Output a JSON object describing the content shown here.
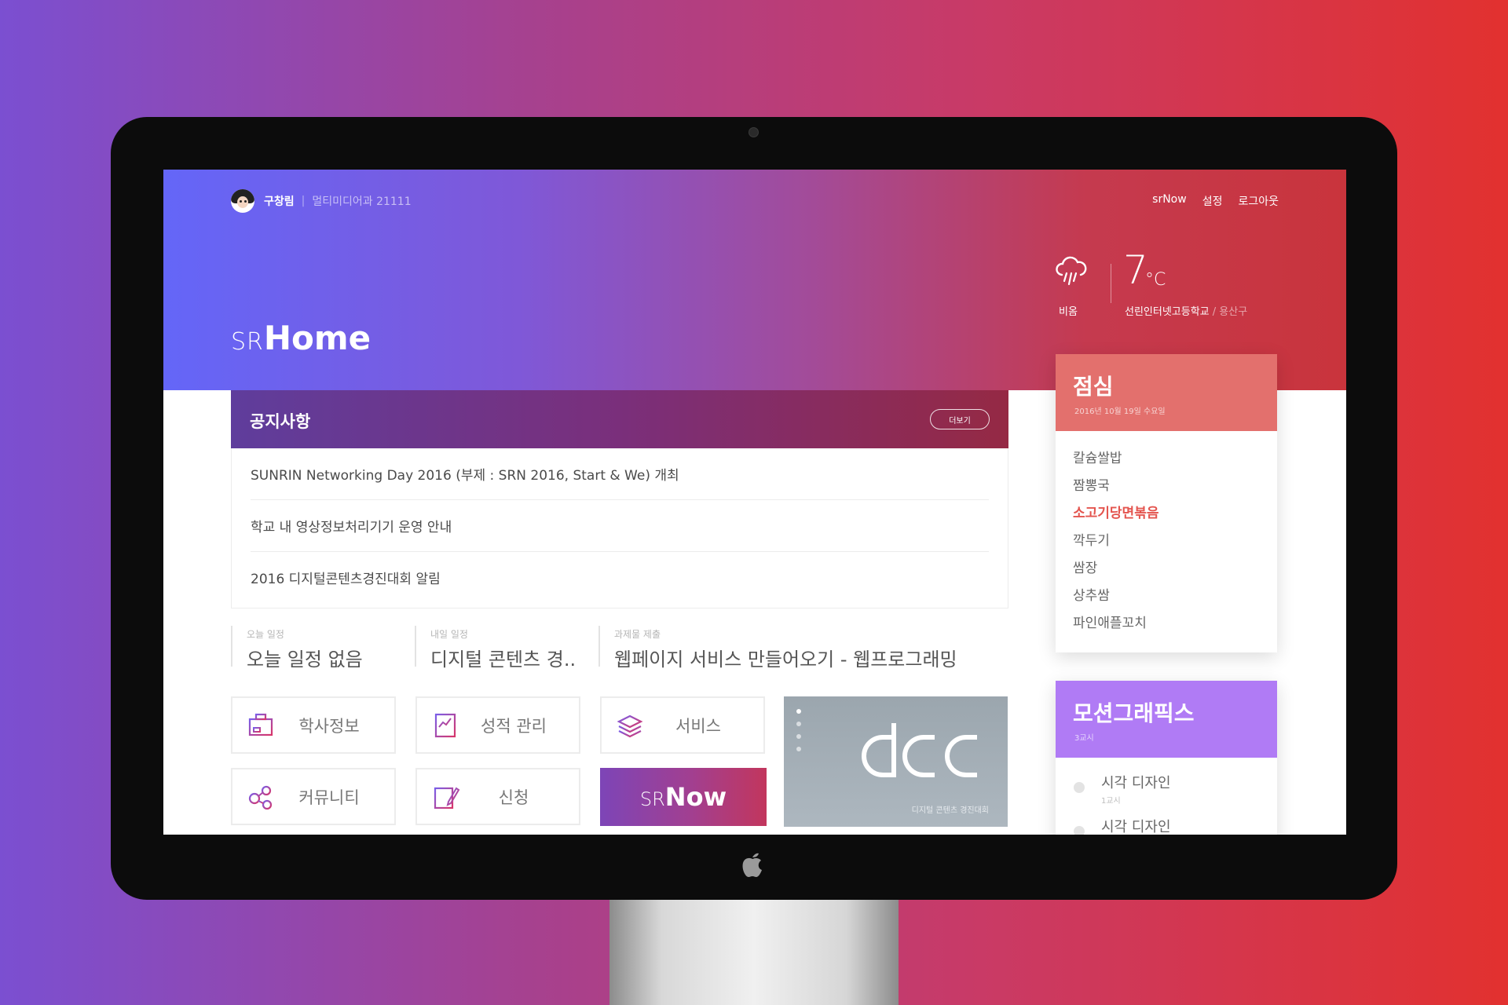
{
  "colors": {
    "background_start": "#7b4fd1",
    "background_end": "#e2312f",
    "hero_start": "#6466f8",
    "hero_end": "#c9343c",
    "lunch_accent": "#e3706d",
    "motion_accent": "#b07bf5",
    "highlight": "#e4554f"
  },
  "user": {
    "name": "구창림",
    "separator": "|",
    "department": "멀티미디어과 21111",
    "avatar_icon": "user-avatar"
  },
  "nav": {
    "items": [
      "srNow",
      "설정",
      "로그아웃"
    ]
  },
  "brand": {
    "prefix": "SR",
    "word": "Home"
  },
  "weather": {
    "icon": "rain-cloud-icon",
    "condition": "비옴",
    "temperature": "7",
    "unit": "°C",
    "location": "선린인터넷고등학교",
    "district": "/ 용산구"
  },
  "notice": {
    "title": "공지사항",
    "more_label": "더보기",
    "items": [
      "SUNRIN Networking Day 2016 (부제 : SRN 2016, Start & We) 개최",
      "학교 내 영상정보처리기기 운영 안내",
      "2016 디지털콘텐츠경진대회 알림"
    ]
  },
  "schedule": {
    "today": {
      "caption": "오늘 일정",
      "value": "오늘 일정 없음"
    },
    "tomorrow": {
      "caption": "내일 일정",
      "value": "디지털 콘텐츠 경.."
    },
    "assignment": {
      "caption": "과제물 제출",
      "value": "웹페이지 서비스 만들어오기 - 웹프로그래밍"
    }
  },
  "tiles": [
    {
      "label": "학사정보",
      "icon": "academic-info-icon"
    },
    {
      "label": "성적 관리",
      "icon": "grade-chart-icon"
    },
    {
      "label": "서비스",
      "icon": "layers-icon"
    },
    {
      "label": "커뮤니티",
      "icon": "community-icon"
    },
    {
      "label": "신청",
      "icon": "application-pen-icon"
    }
  ],
  "srnow": {
    "prefix": "SR",
    "word": "Now"
  },
  "dcc": {
    "logo_text": "dcc",
    "caption": "디지털 콘텐츠 경진대회"
  },
  "lunch": {
    "title": "점심",
    "date": "2016년 10월 19일 수요일",
    "items": [
      "칼슘쌀밥",
      "짬뽕국",
      "소고기당면볶음",
      "깍두기",
      "쌈장",
      "상추쌈",
      "파인애플꼬치"
    ],
    "highlight_index": 2
  },
  "motion": {
    "title": "모션그래픽스",
    "sub": "3교시",
    "items": [
      {
        "name": "시각 디자인",
        "period": "1교시"
      },
      {
        "name": "시각 디자인",
        "period": ""
      }
    ]
  }
}
